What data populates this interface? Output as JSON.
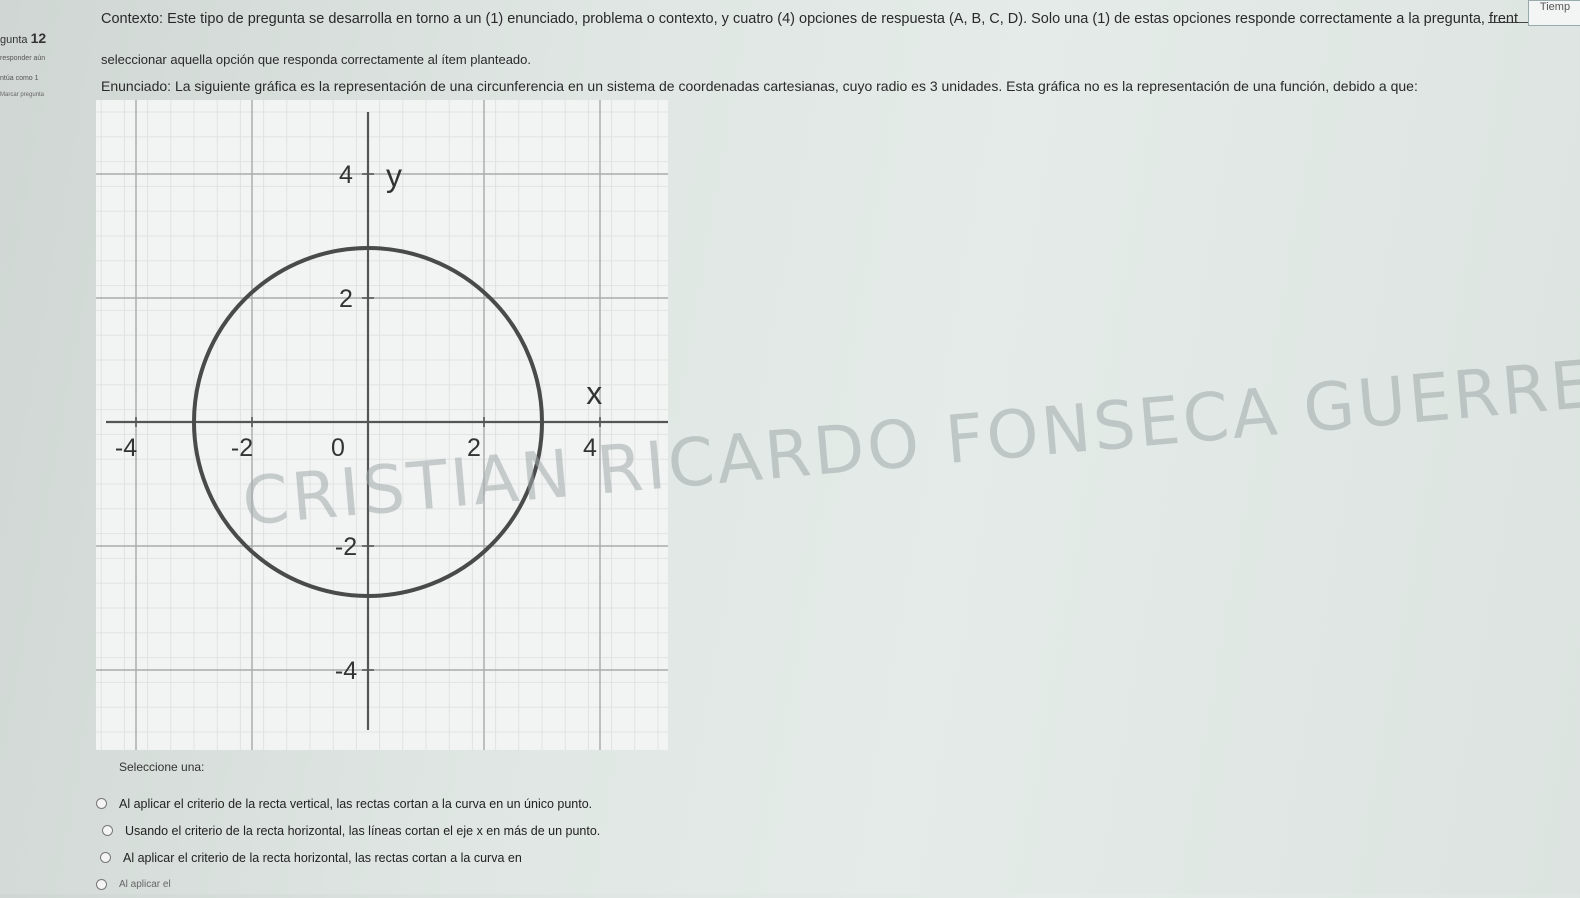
{
  "sidebar": {
    "question_prefix": "gunta",
    "question_number": "12",
    "status": "responder aún",
    "points": "ntúa como 1",
    "flag": "Marcar pregunta"
  },
  "timer": {
    "label": "Tiemp"
  },
  "question": {
    "context": "Contexto: Este tipo de pregunta se desarrolla en torno a un (1) enunciado, problema o contexto, y cuatro (4) opciones de respuesta (A, B, C, D). Solo una (1) de estas opciones responde correctamente a la pregunta, frent",
    "context_cont": "seleccionar aquella opción que responda correctamente al ítem planteado.",
    "statement": "Enunciado: La siguiente gráfica es la representación de una circunferencia en un sistema de coordenadas cartesianas, cuyo radio es 3 unidades. Esta gráfica no es la representación de una función, debido a que:",
    "select_label": "Seleccione una:",
    "options": [
      "Al aplicar el criterio de la recta vertical, las rectas cortan a la curva en un único punto.",
      "Usando el criterio de la recta horizontal, las líneas cortan el eje x en más de un punto.",
      "Al aplicar el criterio de la recta horizontal, las rectas cortan a la curva en",
      "Al aplicar el"
    ]
  },
  "watermark": "CRISTIAN RICARDO FONSECA GUERRERO",
  "chart_data": {
    "type": "scatter",
    "shape": "circle",
    "center": [
      0,
      0
    ],
    "radius": 3,
    "xlabel": "x",
    "ylabel": "y",
    "xlim": [
      -5,
      5
    ],
    "ylim": [
      -5,
      5
    ],
    "x_ticks": [
      "-4",
      "-2",
      "0",
      "2",
      "4"
    ],
    "y_ticks": [
      "4",
      "2",
      "-2",
      "-4"
    ],
    "grid": true,
    "curve_color": "#4a4a4a"
  }
}
